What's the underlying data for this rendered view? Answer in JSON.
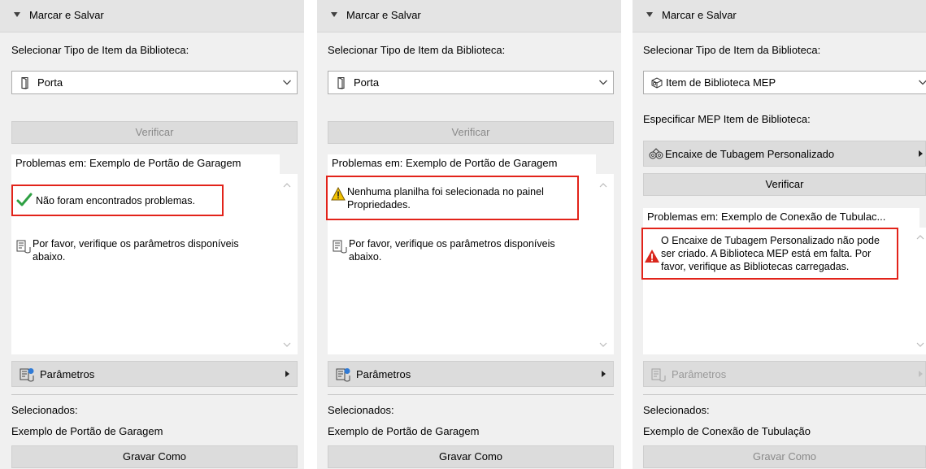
{
  "panels": [
    {
      "header": "Marcar e Salvar",
      "select_label": "Selecionar Tipo de Item da Biblioteca:",
      "dropdown_value": "Porta",
      "verify_label": "Verificar",
      "problems_title": "Problemas em: Exemplo de Portão de Garagem",
      "message": "Não foram encontrados problemas.",
      "info_line1": "Por favor, verifique os parâmetros disponíveis",
      "info_line2": "abaixo.",
      "params_label": "Parâmetros",
      "selected_label": "Selecionados:",
      "selected_value": "Exemplo de Portão de Garagem",
      "save_label": "Gravar Como"
    },
    {
      "header": "Marcar e Salvar",
      "select_label": "Selecionar Tipo de Item da Biblioteca:",
      "dropdown_value": "Porta",
      "verify_label": "Verificar",
      "problems_title": "Problemas em: Exemplo de Portão de Garagem",
      "message_line1": "Nenhuma planilha foi selecionada no painel",
      "message_line2": "Propriedades.",
      "info_line1": "Por favor, verifique os parâmetros disponíveis",
      "info_line2": "abaixo.",
      "params_label": "Parâmetros",
      "selected_label": "Selecionados:",
      "selected_value": "Exemplo de Portão de Garagem",
      "save_label": "Gravar Como"
    },
    {
      "header": "Marcar e Salvar",
      "select_label": "Selecionar Tipo de Item da Biblioteca:",
      "dropdown_value": "Item de Biblioteca MEP",
      "specify_label": "Especificar MEP Item de Biblioteca:",
      "mep_item": "Encaixe de Tubagem Personalizado",
      "verify_label": "Verificar",
      "problems_title": "Problemas em: Exemplo de Conexão de Tubulac...",
      "message_line1": "O Encaixe de Tubagem Personalizado não pode",
      "message_line2": "ser criado. A Biblioteca MEP está em falta. Por",
      "message_line3": "favor, verifique as Bibliotecas carregadas.",
      "params_label": "Parâmetros",
      "selected_label": "Selecionados:",
      "selected_value": "Exemplo de Conexão de Tubulação",
      "save_label": "Gravar Como"
    }
  ],
  "colors": {
    "highlight": "#e2231a",
    "ok": "#2ea043",
    "warning": "#f2c200",
    "error": "#d9261c"
  }
}
